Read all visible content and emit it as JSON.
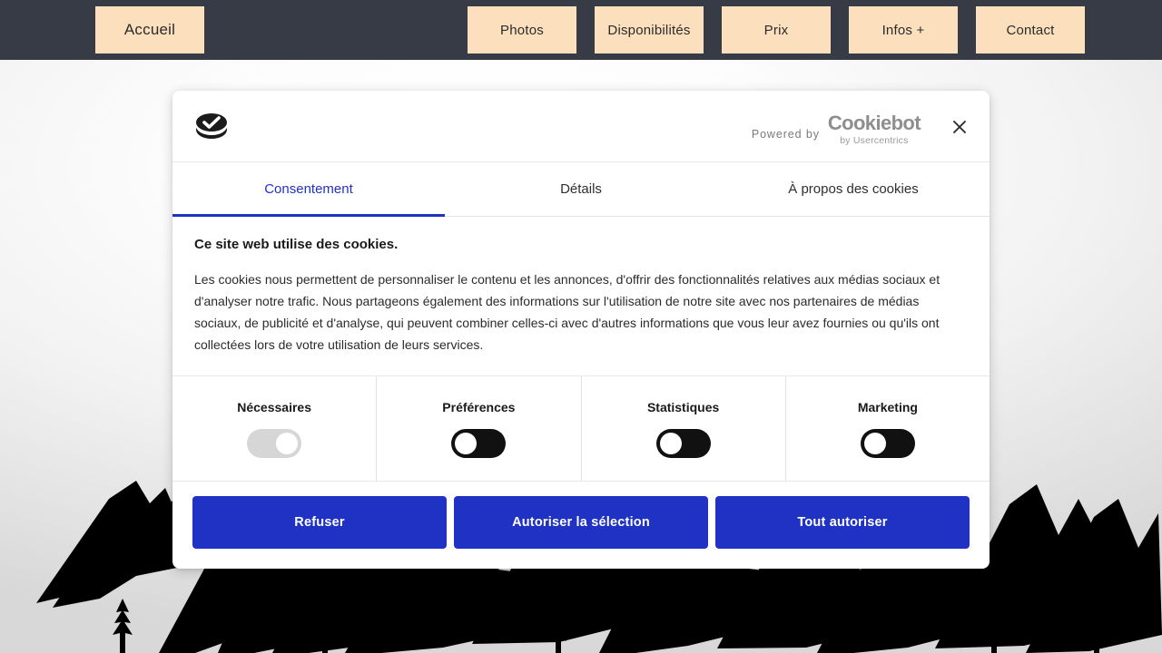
{
  "colors": {
    "nav_bar_bg": "#363b45",
    "nav_button_bg": "#fce0be",
    "accent_blue": "#1f32c4",
    "toggle_on_track": "#111111",
    "toggle_locked_track": "#d6d6d6",
    "dialog_bg": "#ffffff"
  },
  "nav": {
    "home_label": "Accueil",
    "items": [
      {
        "label": "Photos"
      },
      {
        "label": "Disponibilités"
      },
      {
        "label": "Prix"
      },
      {
        "label": "Infos +"
      },
      {
        "label": "Contact"
      }
    ]
  },
  "dialog": {
    "logo_icon": "cookie-check-icon",
    "powered_by_label": "Powered by",
    "brand_name": "Cookiebot",
    "brand_subtitle": "by Usercentrics",
    "close_icon": "close-icon",
    "tabs": [
      {
        "label": "Consentement",
        "active": true
      },
      {
        "label": "Détails",
        "active": false
      },
      {
        "label": "À propos des cookies",
        "active": false
      }
    ],
    "body": {
      "heading": "Ce site web utilise des cookies.",
      "paragraph": "Les cookies nous permettent de personnaliser le contenu et les annonces, d'offrir des fonctionnalités relatives aux médias sociaux et d'analyser notre trafic. Nous partageons également des informations sur l'utilisation de notre site avec nos partenaires de médias sociaux, de publicité et d'analyse, qui peuvent combiner celles-ci avec d'autres informations que vous leur avez fournies ou qu'ils ont collectées lors de votre utilisation de leurs services."
    },
    "categories": [
      {
        "label": "Nécessaires",
        "state": "on",
        "locked": true
      },
      {
        "label": "Préférences",
        "state": "off",
        "locked": false
      },
      {
        "label": "Statistiques",
        "state": "off",
        "locked": false
      },
      {
        "label": "Marketing",
        "state": "off",
        "locked": false
      }
    ],
    "buttons": [
      {
        "label": "Refuser"
      },
      {
        "label": "Autoriser la sélection"
      },
      {
        "label": "Tout autoriser"
      }
    ]
  },
  "background": {
    "description": "mountain-silhouette-illustration"
  }
}
